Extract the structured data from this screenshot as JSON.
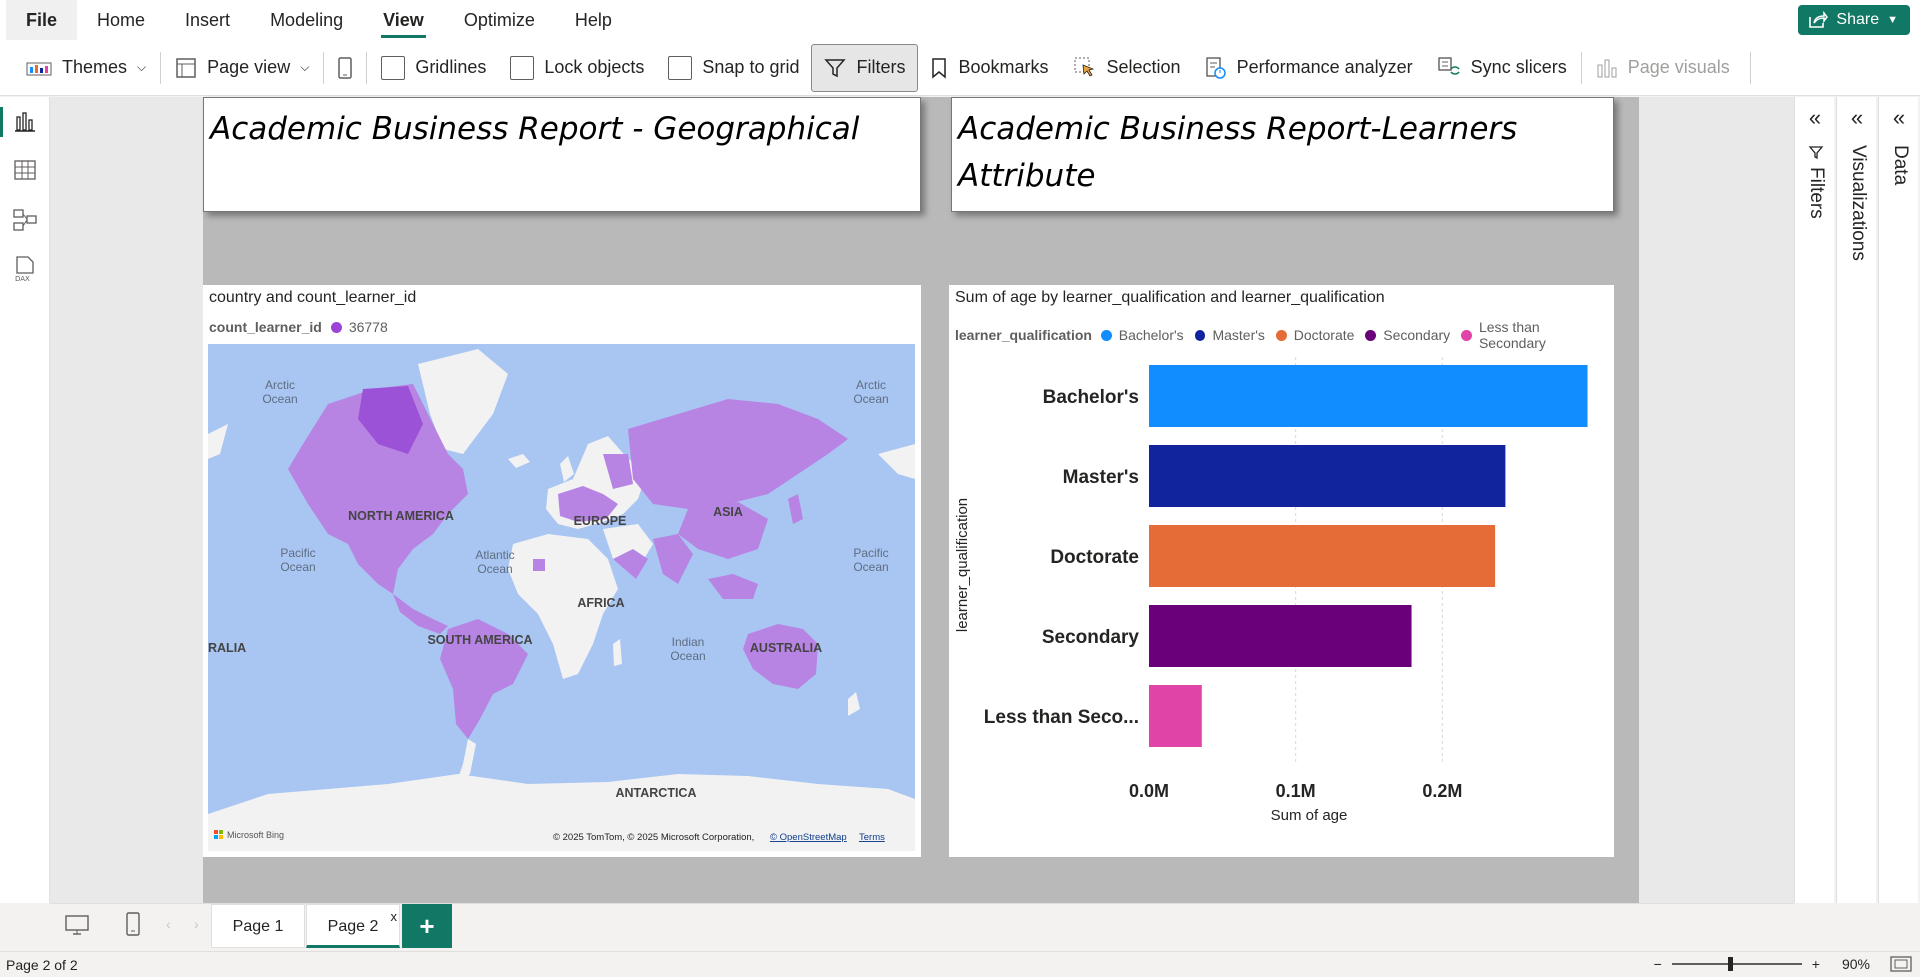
{
  "menu": {
    "items": [
      "File",
      "Home",
      "Insert",
      "Modeling",
      "View",
      "Optimize",
      "Help"
    ],
    "active": "View",
    "share_label": "Share"
  },
  "ribbon": {
    "themes": "Themes",
    "page_view": "Page view",
    "gridlines": "Gridlines",
    "lock_objects": "Lock objects",
    "snap_to_grid": "Snap to grid",
    "filters": "Filters",
    "bookmarks": "Bookmarks",
    "selection": "Selection",
    "performance_analyzer": "Performance analyzer",
    "sync_slicers": "Sync slicers",
    "page_visuals": "Page visuals"
  },
  "report": {
    "title_left": "Academic Business Report - Geographical",
    "title_right_line1": "Academic Business Report-Learners",
    "title_right_line2": "Attribute",
    "map_visual": {
      "title": "country and count_learner_id",
      "legend_title": "count_learner_id",
      "legend_value": "36778",
      "legend_color": "#9c44d8",
      "continent_labels": {
        "north_america": "NORTH AMERICA",
        "south_america": "SOUTH AMERICA",
        "europe": "EUROPE",
        "asia": "ASIA",
        "africa": "AFRICA",
        "australia": "AUSTRALIA",
        "antarctica": "ANTARCTICA",
        "ralia": "RALIA"
      },
      "ocean_labels": {
        "arctic_l1": "Arctic",
        "arctic_l2": "Ocean",
        "pacific_l1": "Pacific",
        "pacific_l2": "Ocean",
        "atlantic_l1": "Atlantic",
        "atlantic_l2": "Ocean",
        "indian_l1": "Indian",
        "indian_l2": "Ocean"
      },
      "bing": "Microsoft Bing",
      "copyright": "© 2025 TomTom, © 2025 Microsoft Corporation,",
      "osm": "© OpenStreetMap",
      "terms": "Terms"
    },
    "bar_visual": {
      "title": "Sum of age by learner_qualification and learner_qualification",
      "legend_title": "learner_qualification"
    }
  },
  "chart_data": {
    "type": "bar",
    "orientation": "horizontal",
    "title": "Sum of age by learner_qualification and learner_qualification",
    "xlabel": "Sum of age",
    "ylabel": "learner_qualification",
    "categories": [
      "Bachelor's",
      "Master's",
      "Doctorate",
      "Secondary",
      "Less than Secondary"
    ],
    "category_tick_labels": [
      "Bachelor's",
      "Master's",
      "Doctorate",
      "Secondary",
      "Less than Seco..."
    ],
    "values": [
      299000,
      243000,
      236000,
      179000,
      36000
    ],
    "colors": [
      "#118dff",
      "#12239e",
      "#e66c37",
      "#6b007b",
      "#e044a7"
    ],
    "x_ticks": [
      "0.0M",
      "0.1M",
      "0.2M"
    ],
    "xlim": [
      0,
      300000
    ],
    "legend_position": "top",
    "grid": true
  },
  "pages": {
    "tabs": [
      "Page 1",
      "Page 2"
    ],
    "active": "Page 2"
  },
  "panes": {
    "filters": "Filters",
    "visualizations": "Visualizations",
    "data": "Data"
  },
  "status": {
    "page_info": "Page 2 of 2",
    "zoom": "90%"
  }
}
